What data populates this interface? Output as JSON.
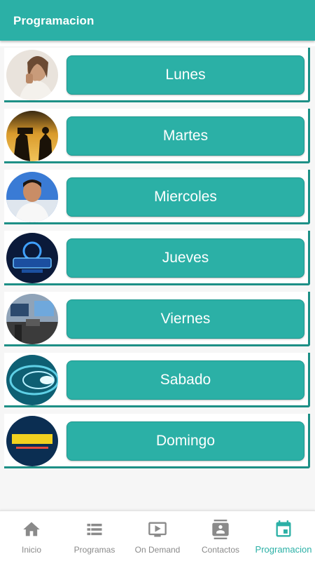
{
  "header": {
    "title": "Programacion"
  },
  "colors": {
    "accent": "#2bb0a6",
    "accent_dark": "#1d8f86",
    "inactive": "#8a8a8a"
  },
  "schedule": {
    "days": [
      {
        "label": "Lunes",
        "thumbnail": "woman-portrait-photo"
      },
      {
        "label": "Martes",
        "thumbnail": "camera-crew-sunset-photo"
      },
      {
        "label": "Miercoles",
        "thumbnail": "man-portrait-photo"
      },
      {
        "label": "Jueves",
        "thumbnail": "pasion-logo-photo"
      },
      {
        "label": "Viernes",
        "thumbnail": "studio-set-photo"
      },
      {
        "label": "Sabado",
        "thumbnail": "abstract-tunnel-photo"
      },
      {
        "label": "Domingo",
        "thumbnail": "el-chili-logo-photo"
      }
    ]
  },
  "bottom_nav": {
    "items": [
      {
        "label": "Inicio",
        "icon": "home-icon"
      },
      {
        "label": "Programas",
        "icon": "list-icon"
      },
      {
        "label": "On Demand",
        "icon": "play-icon"
      },
      {
        "label": "Contactos",
        "icon": "contacts-icon"
      },
      {
        "label": "Programacion",
        "icon": "calendar-icon",
        "active": true
      }
    ]
  }
}
